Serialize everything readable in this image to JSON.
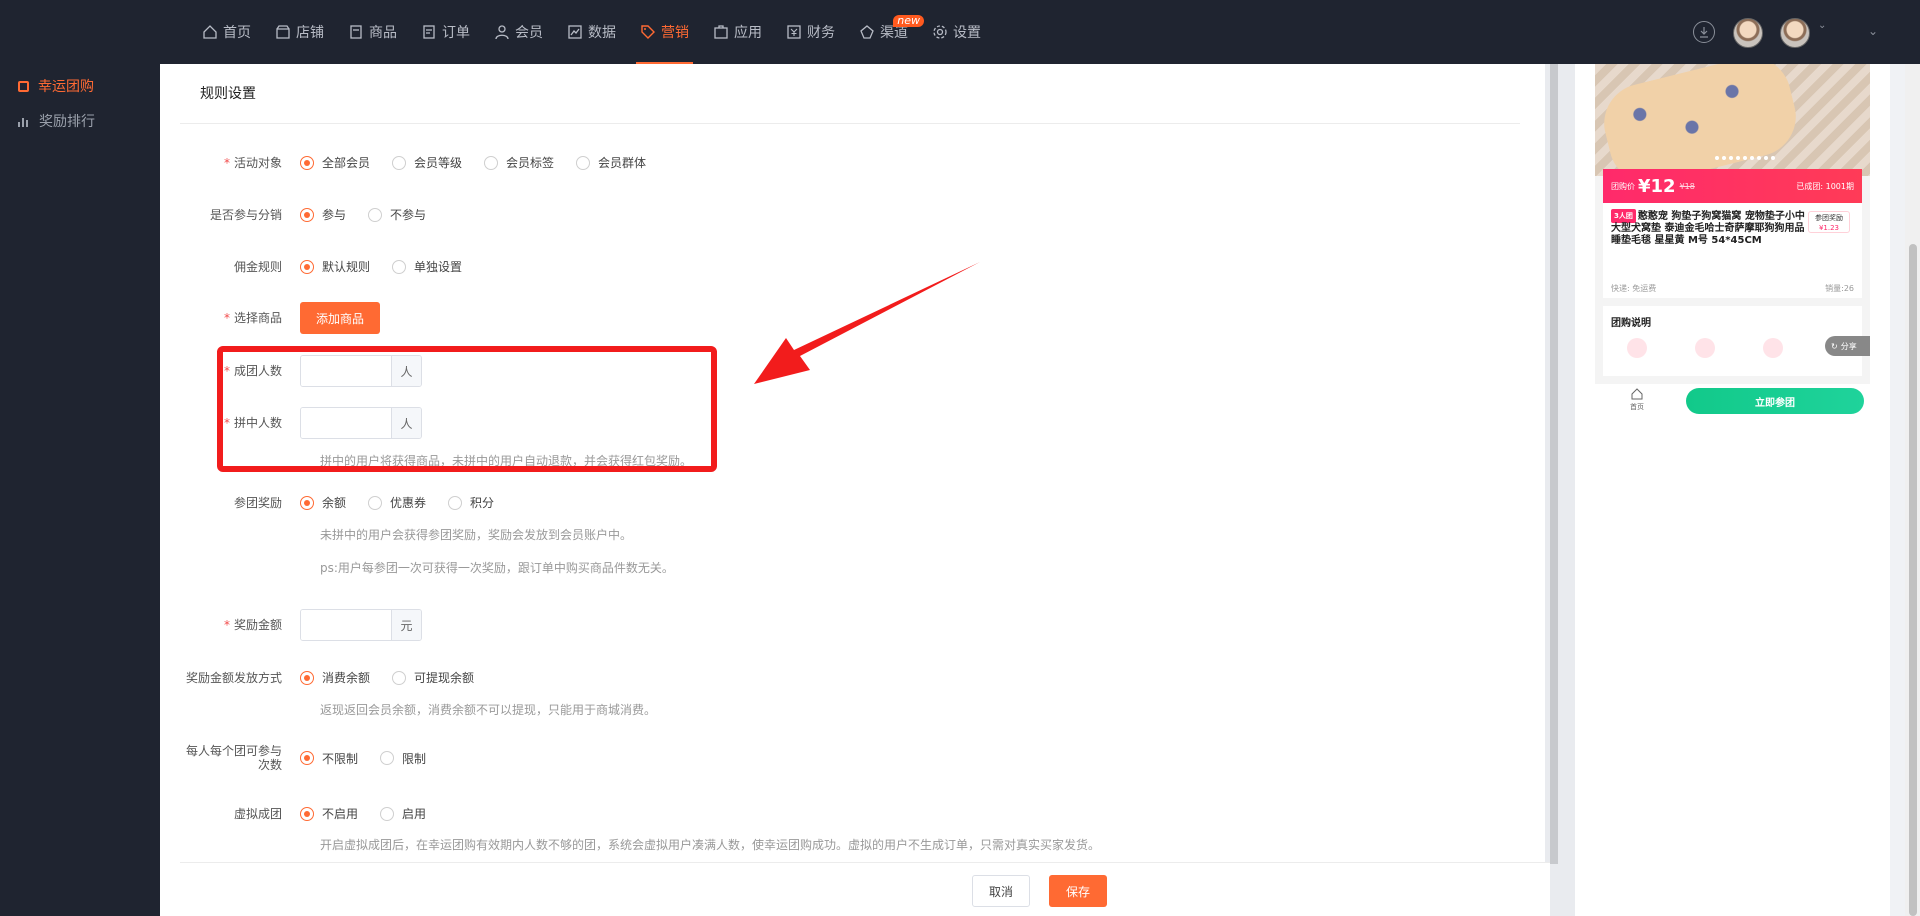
{
  "nav": {
    "items": [
      {
        "label": "首页",
        "icon": "home-icon"
      },
      {
        "label": "店铺",
        "icon": "store-icon"
      },
      {
        "label": "商品",
        "icon": "goods-icon"
      },
      {
        "label": "订单",
        "icon": "order-icon"
      },
      {
        "label": "会员",
        "icon": "user-icon"
      },
      {
        "label": "数据",
        "icon": "chart-icon"
      },
      {
        "label": "营销",
        "icon": "tag-icon",
        "active": true
      },
      {
        "label": "应用",
        "icon": "app-icon"
      },
      {
        "label": "财务",
        "icon": "finance-icon"
      },
      {
        "label": "渠道",
        "icon": "channel-icon",
        "badge": "new"
      },
      {
        "label": "设置",
        "icon": "gear-icon"
      }
    ]
  },
  "sidebar": {
    "items": [
      {
        "label": "幸运团购",
        "active": true
      },
      {
        "label": "奖励排行"
      }
    ]
  },
  "section": {
    "title": "规则设置"
  },
  "form": {
    "activity_target": {
      "label": "活动对象",
      "options": [
        "全部会员",
        "会员等级",
        "会员标签",
        "会员群体"
      ],
      "selected": "全部会员"
    },
    "distribution": {
      "label": "是否参与分销",
      "options": [
        "参与",
        "不参与"
      ],
      "selected": "参与"
    },
    "commission": {
      "label": "佣金规则",
      "options": [
        "默认规则",
        "单独设置"
      ],
      "selected": "默认规则"
    },
    "select_goods": {
      "label": "选择商品",
      "button": "添加商品"
    },
    "group_size": {
      "label": "成团人数",
      "value": "",
      "unit": "人"
    },
    "winner_count": {
      "label": "拼中人数",
      "value": "",
      "unit": "人",
      "help": "拼中的用户将获得商品，未拼中的用户自动退款，并会获得红包奖励。"
    },
    "join_reward": {
      "label": "参团奖励",
      "options": [
        "余额",
        "优惠券",
        "积分"
      ],
      "selected": "余额",
      "help1": "未拼中的用户会获得参团奖励，奖励会发放到会员账户中。",
      "help2": "ps:用户每参团一次可获得一次奖励，跟订单中购买商品件数无关。"
    },
    "reward_amount": {
      "label": "奖励金额",
      "value": "",
      "unit": "元"
    },
    "payout_method": {
      "label": "奖励金额发放方式",
      "options": [
        "消费余额",
        "可提现余额"
      ],
      "selected": "消费余额",
      "help": "返现返回会员余额，消费余额不可以提现，只能用于商城消费。"
    },
    "join_limit": {
      "label": "每人每个团可参与次数",
      "options": [
        "不限制",
        "限制"
      ],
      "selected": "不限制"
    },
    "virtual_group": {
      "label": "虚拟成团",
      "options": [
        "不启用",
        "启用"
      ],
      "selected": "不启用",
      "help": "开启虚拟成团后，在幸运团购有效期内人数不够的团，系统会虚拟用户凑满人数，使幸运团购成功。虚拟的用户不生成订单，只需对真实买家发货。"
    }
  },
  "footer": {
    "cancel": "取消",
    "save": "保存"
  },
  "preview": {
    "price_label": "团购价",
    "price": "¥12",
    "original_price": "¥18",
    "sold": "已成团: 1001期",
    "team_tag": "3人团",
    "title": "憨憨宠 狗垫子狗窝猫窝 宠物垫子小中大型犬窝垫 泰迪金毛哈士奇萨摩耶狗狗用品睡垫毛毯 星星黄 M号 54*45CM",
    "reward_label": "参团奖励",
    "reward_value": "¥1.23",
    "shipping": "快递: 免运费",
    "sales": "销量:26",
    "explain_title": "团购说明",
    "share": "分享",
    "home": "首页",
    "join_button": "立即参团"
  },
  "colors": {
    "accent": "#ff6a33",
    "highlight": "#f21c1c",
    "join": "#12c98a",
    "price": "#ff2a6b"
  }
}
